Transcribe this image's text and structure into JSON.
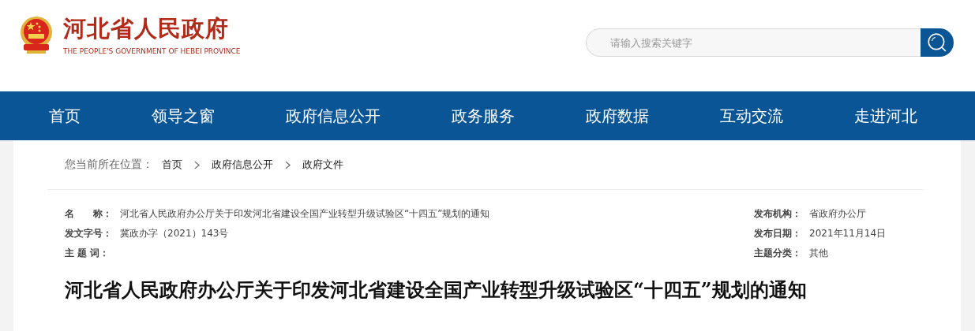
{
  "header": {
    "title": "河北省人民政府",
    "subtitle": "THE PEOPLE'S GOVERNMENT OF HEBEI PROVINCE",
    "search": {
      "placeholder": "请输入搜索关键字"
    }
  },
  "nav": [
    {
      "label": "首页"
    },
    {
      "label": "领导之窗"
    },
    {
      "label": "政府信息公开"
    },
    {
      "label": "政务服务"
    },
    {
      "label": "政府数据"
    },
    {
      "label": "互动交流"
    },
    {
      "label": "走进河北"
    }
  ],
  "breadcrumb": {
    "prefix": "您当前所在位置：",
    "items": [
      {
        "label": "首页"
      },
      {
        "label": "政府信息公开"
      },
      {
        "label": "政府文件"
      }
    ]
  },
  "meta_left": [
    {
      "label": "名　　称：",
      "value": "河北省人民政府办公厅关于印发河北省建设全国产业转型升级试验区“十四五”规划的通知"
    },
    {
      "label": "发文字号：",
      "value": "冀政办字（2021）143号"
    },
    {
      "label": "主 题 词："
    }
  ],
  "meta_right": [
    {
      "label": "发布机构：",
      "value": "省政府办公厅"
    },
    {
      "label": "发布日期：",
      "value": "2021年11月14日"
    },
    {
      "label": "主题分类：",
      "value": "其他"
    }
  ],
  "article_title": "河北省人民政府办公厅关于印发河北省建设全国产业转型升级试验区“十四五”规划的通知"
}
